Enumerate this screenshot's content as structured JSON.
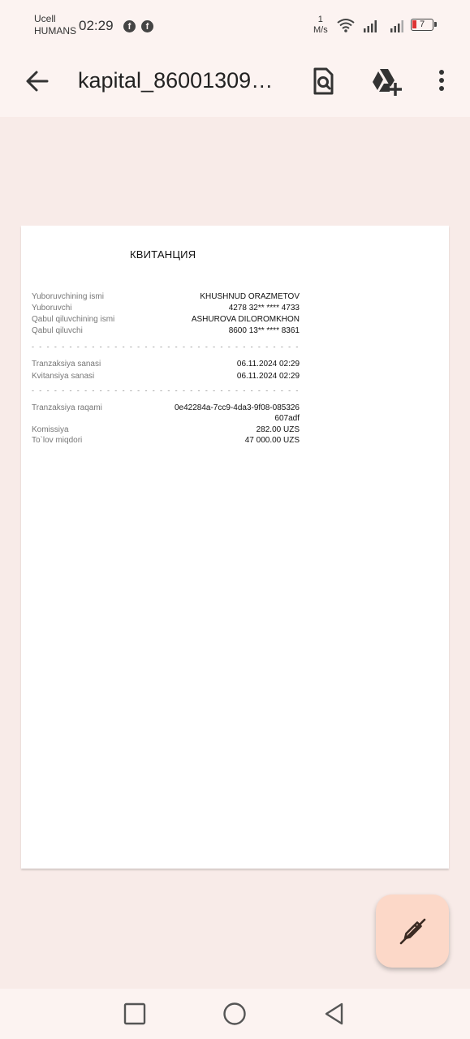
{
  "status_bar": {
    "carrier_line1": "Ucell",
    "carrier_line2": "HUMANS",
    "time": "02:29",
    "notification_icons": [
      "facebook-icon",
      "facebook-icon"
    ],
    "network_speed_value": "1",
    "network_speed_unit": "M/s",
    "battery_level": "7",
    "battery_color": "#dd3333"
  },
  "app_bar": {
    "title": "kapital_86001309…",
    "actions": [
      "back-arrow-icon",
      "document-search-icon",
      "drive-add-icon",
      "more-vert-icon"
    ]
  },
  "document": {
    "title": "КВИТАНЦИЯ",
    "section1": [
      {
        "label": "Yuboruvchining ismi",
        "value": "KHUSHNUD ORAZMETOV"
      },
      {
        "label": "Yuboruvchi",
        "value": "4278 32** **** 4733"
      },
      {
        "label": "Qabul qiluvchining ismi",
        "value": "ASHUROVA DILOROMKHON"
      },
      {
        "label": "Qabul qiluvchi",
        "value": "8600 13** **** 8361"
      }
    ],
    "section2": [
      {
        "label": "Tranzaksiya sanasi",
        "value": "06.11.2024 02:29"
      },
      {
        "label": "Kvitansiya sanasi",
        "value": "06.11.2024 02:29"
      }
    ],
    "transaction_label": "Tranzaksiya raqami",
    "transaction_value_line1": "0e42284a-7cc9-4da3-9f08-085326",
    "transaction_value_line2": "607adf",
    "section3": [
      {
        "label": "Komissiya",
        "value": "282.00 UZS"
      },
      {
        "label": "To`lov miqdori",
        "value": "47 000.00 UZS"
      }
    ],
    "separator": "- - - - - - - - - - - - - - - - - - - - - - - - - - - - - - - - - - - - - - - -"
  },
  "fab": {
    "icon": "edit-pen-icon",
    "color": "#fcd8c8"
  },
  "nav_bar": {
    "buttons": [
      "recents-square-icon",
      "home-circle-icon",
      "back-triangle-icon"
    ]
  }
}
